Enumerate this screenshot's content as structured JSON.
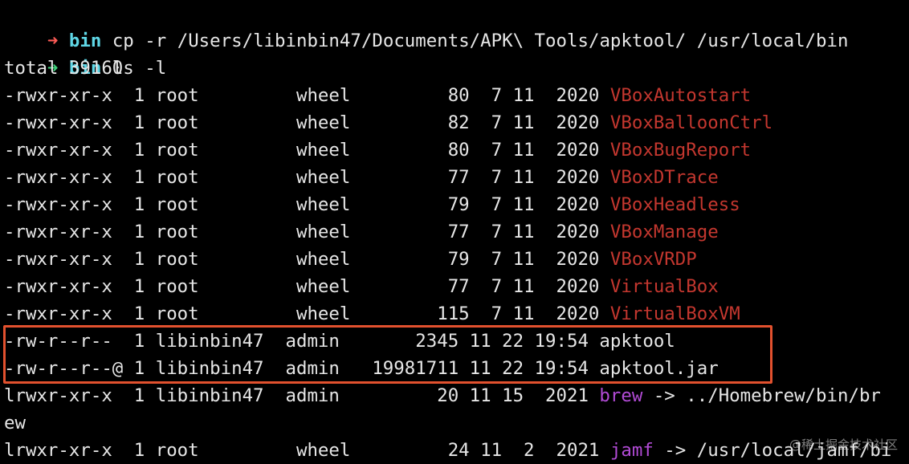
{
  "terminal": {
    "commands": [
      {
        "arrow": "➜",
        "arrow_color": "#ff5c57",
        "dir": "bin",
        "text": "cp -r /Users/libinbin47/Documents/APK\\ Tools/apktool/ /usr/local/bin"
      },
      {
        "arrow": "➜",
        "arrow_color": "#3fd07a",
        "dir": "bin",
        "text": "ls -l"
      }
    ],
    "total_line": "total 39160",
    "rows": [
      {
        "meta": "-rwxr-xr-x  1 root         wheel         80  7 11  2020 ",
        "name": "VBoxAutostart",
        "kind": "exec",
        "link": ""
      },
      {
        "meta": "-rwxr-xr-x  1 root         wheel         82  7 11  2020 ",
        "name": "VBoxBalloonCtrl",
        "kind": "exec",
        "link": ""
      },
      {
        "meta": "-rwxr-xr-x  1 root         wheel         80  7 11  2020 ",
        "name": "VBoxBugReport",
        "kind": "exec",
        "link": ""
      },
      {
        "meta": "-rwxr-xr-x  1 root         wheel         77  7 11  2020 ",
        "name": "VBoxDTrace",
        "kind": "exec",
        "link": ""
      },
      {
        "meta": "-rwxr-xr-x  1 root         wheel         79  7 11  2020 ",
        "name": "VBoxHeadless",
        "kind": "exec",
        "link": ""
      },
      {
        "meta": "-rwxr-xr-x  1 root         wheel         77  7 11  2020 ",
        "name": "VBoxManage",
        "kind": "exec",
        "link": ""
      },
      {
        "meta": "-rwxr-xr-x  1 root         wheel         79  7 11  2020 ",
        "name": "VBoxVRDP",
        "kind": "exec",
        "link": ""
      },
      {
        "meta": "-rwxr-xr-x  1 root         wheel         77  7 11  2020 ",
        "name": "VirtualBox",
        "kind": "exec",
        "link": ""
      },
      {
        "meta": "-rwxr-xr-x  1 root         wheel        115  7 11  2020 ",
        "name": "VirtualBoxVM",
        "kind": "exec",
        "link": ""
      },
      {
        "meta": "-rw-r--r--  1 libinbin47  admin       2345 11 22 19:54 ",
        "name": "apktool",
        "kind": "plain",
        "link": ""
      },
      {
        "meta": "-rw-r--r--@ 1 libinbin47  admin   19981711 11 22 19:54 ",
        "name": "apktool.jar",
        "kind": "plain",
        "link": ""
      },
      {
        "meta": "lrwxr-xr-x  1 libinbin47  admin         20 11 15  2021 ",
        "name": "brew",
        "kind": "link",
        "link": " -> ../Homebrew/bin/br"
      },
      {
        "meta": "ew",
        "name": "",
        "kind": "plain",
        "link": ""
      },
      {
        "meta": "lrwxr-xr-x  1 root         wheel         24 11  2  2021 ",
        "name": "jamf",
        "kind": "link",
        "link": " -> /usr/local/jamf/bi"
      }
    ],
    "colors": {
      "background": "#000000",
      "text": "#e6e6e6",
      "executable": "#c4372f",
      "symlink": "#b24bd6",
      "prompt_ok": "#3fd07a",
      "prompt_dir": "#5fd7e6",
      "highlight_border": "#e2512e"
    }
  },
  "watermark": "@稀土掘金技术社区"
}
